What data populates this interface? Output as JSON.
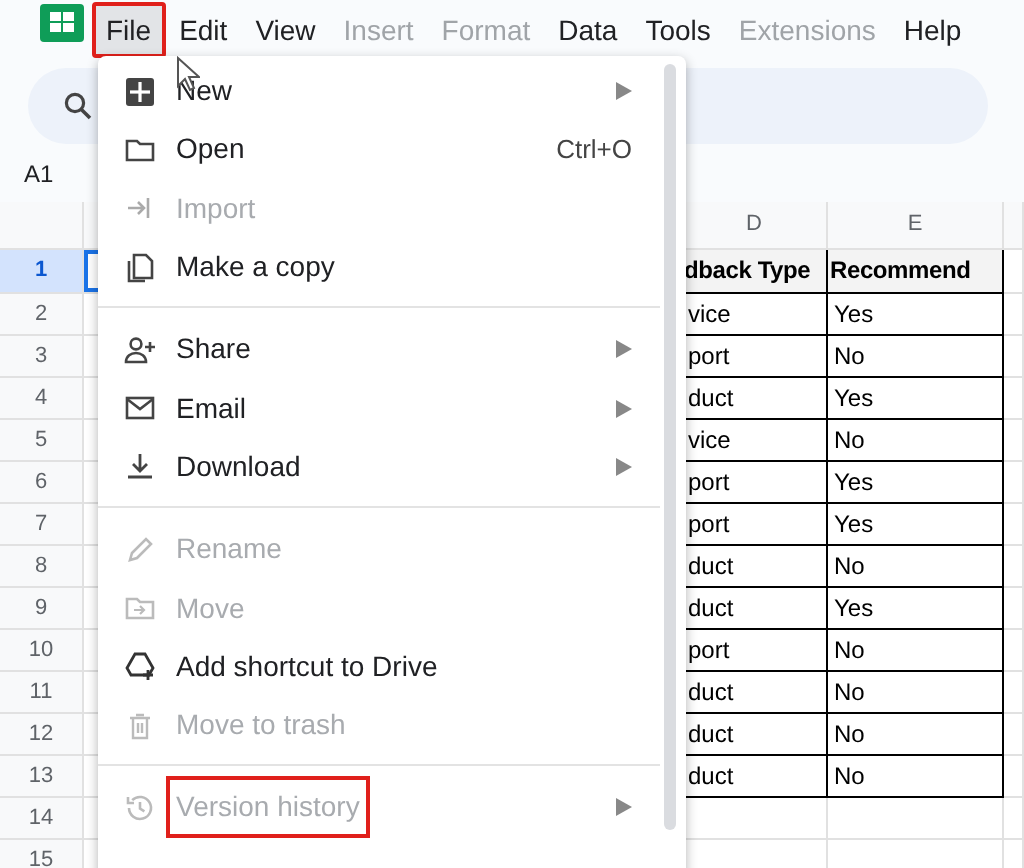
{
  "menu_bar": [
    {
      "label": "File",
      "selected": true,
      "highlighted": true,
      "disabled": false
    },
    {
      "label": "Edit",
      "selected": false,
      "highlighted": false,
      "disabled": false
    },
    {
      "label": "View",
      "selected": false,
      "highlighted": false,
      "disabled": false
    },
    {
      "label": "Insert",
      "selected": false,
      "highlighted": false,
      "disabled": true
    },
    {
      "label": "Format",
      "selected": false,
      "highlighted": false,
      "disabled": true
    },
    {
      "label": "Data",
      "selected": false,
      "highlighted": false,
      "disabled": false
    },
    {
      "label": "Tools",
      "selected": false,
      "highlighted": false,
      "disabled": false
    },
    {
      "label": "Extensions",
      "selected": false,
      "highlighted": false,
      "disabled": true
    },
    {
      "label": "Help",
      "selected": false,
      "highlighted": false,
      "disabled": false
    }
  ],
  "name_box": "A1",
  "grid": {
    "column_headers": [
      "D",
      "E"
    ],
    "rows": [
      {
        "number": "1",
        "selected": true,
        "header": true,
        "column_d": "dback Type",
        "column_e": "Recommend"
      },
      {
        "number": "2",
        "selected": false,
        "header": false,
        "column_d": "vice",
        "column_e": "Yes"
      },
      {
        "number": "3",
        "selected": false,
        "header": false,
        "column_d": "port",
        "column_e": "No"
      },
      {
        "number": "4",
        "selected": false,
        "header": false,
        "column_d": "duct",
        "column_e": "Yes"
      },
      {
        "number": "5",
        "selected": false,
        "header": false,
        "column_d": "vice",
        "column_e": "No"
      },
      {
        "number": "6",
        "selected": false,
        "header": false,
        "column_d": "port",
        "column_e": "Yes"
      },
      {
        "number": "7",
        "selected": false,
        "header": false,
        "column_d": "port",
        "column_e": "Yes"
      },
      {
        "number": "8",
        "selected": false,
        "header": false,
        "column_d": "duct",
        "column_e": "No"
      },
      {
        "number": "9",
        "selected": false,
        "header": false,
        "column_d": "duct",
        "column_e": "Yes"
      },
      {
        "number": "10",
        "selected": false,
        "header": false,
        "column_d": "port",
        "column_e": "No"
      },
      {
        "number": "11",
        "selected": false,
        "header": false,
        "column_d": "duct",
        "column_e": "No"
      },
      {
        "number": "12",
        "selected": false,
        "header": false,
        "column_d": "duct",
        "column_e": "No"
      },
      {
        "number": "13",
        "selected": false,
        "header": false,
        "column_d": "duct",
        "column_e": "No"
      },
      {
        "number": "14",
        "selected": false
      },
      {
        "number": "15",
        "selected": false
      }
    ]
  },
  "file_menu": {
    "items": [
      {
        "kind": "item",
        "label": "New",
        "disabled": false,
        "submenu": true,
        "highlighted": false
      },
      {
        "kind": "item",
        "label": "Open",
        "shortcut": "Ctrl+O",
        "disabled": false,
        "submenu": false,
        "highlighted": false
      },
      {
        "kind": "item",
        "label": "Import",
        "disabled": true,
        "submenu": false,
        "highlighted": false
      },
      {
        "kind": "item",
        "label": "Make a copy",
        "disabled": false,
        "submenu": false,
        "highlighted": false
      },
      {
        "kind": "divider"
      },
      {
        "kind": "item",
        "label": "Share",
        "disabled": false,
        "submenu": true,
        "highlighted": false
      },
      {
        "kind": "item",
        "label": "Email",
        "disabled": false,
        "submenu": true,
        "highlighted": false
      },
      {
        "kind": "item",
        "label": "Download",
        "disabled": false,
        "submenu": true,
        "highlighted": false
      },
      {
        "kind": "divider"
      },
      {
        "kind": "item",
        "label": "Rename",
        "disabled": true,
        "submenu": false,
        "highlighted": false
      },
      {
        "kind": "item",
        "label": "Move",
        "disabled": true,
        "submenu": false,
        "highlighted": false
      },
      {
        "kind": "item",
        "label": "Add shortcut to Drive",
        "disabled": false,
        "submenu": false,
        "highlighted": false
      },
      {
        "kind": "item",
        "label": "Move to trash",
        "disabled": true,
        "submenu": false,
        "highlighted": false
      },
      {
        "kind": "divider"
      },
      {
        "kind": "item",
        "label": "Version history",
        "disabled": true,
        "submenu": true,
        "highlighted": true
      }
    ]
  }
}
